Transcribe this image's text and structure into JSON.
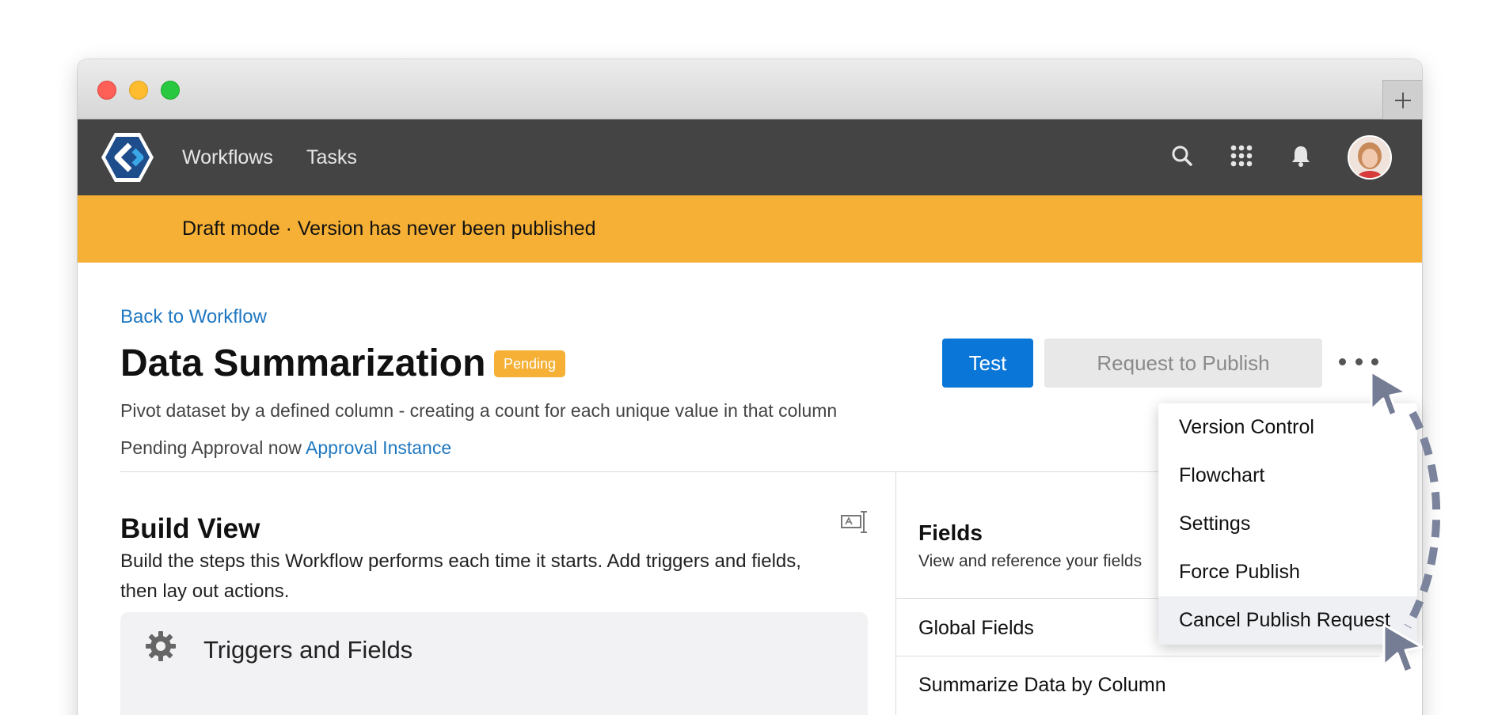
{
  "nav": {
    "links": [
      "Workflows",
      "Tasks"
    ]
  },
  "banner": {
    "text": "Draft mode · Version has never been published"
  },
  "header": {
    "back_link": "Back to Workflow",
    "title": "Data Summarization",
    "status_badge": "Pending",
    "description": "Pivot dataset by a defined column - creating a count for each unique value in that column",
    "pending_prefix": "Pending Approval now",
    "approval_link": "Approval Instance",
    "test_button": "Test",
    "request_button": "Request to Publish"
  },
  "build_view": {
    "title": "Build View",
    "description": "Build the steps this Workflow performs each time it starts. Add triggers and fields, then lay out actions.",
    "card_title": "Triggers and Fields"
  },
  "fields_panel": {
    "title": "Fields",
    "description": "View and reference your fields",
    "rows": [
      "Global Fields",
      "Summarize Data by Column"
    ]
  },
  "more_menu": {
    "items": [
      "Version Control",
      "Flowchart",
      "Settings",
      "Force Publish",
      "Cancel Publish Request"
    ],
    "hovered_index": 4
  },
  "colors": {
    "nav_bg": "#444444",
    "banner_bg": "#f5b035",
    "primary": "#0a76d8",
    "link": "#1f78c1"
  }
}
